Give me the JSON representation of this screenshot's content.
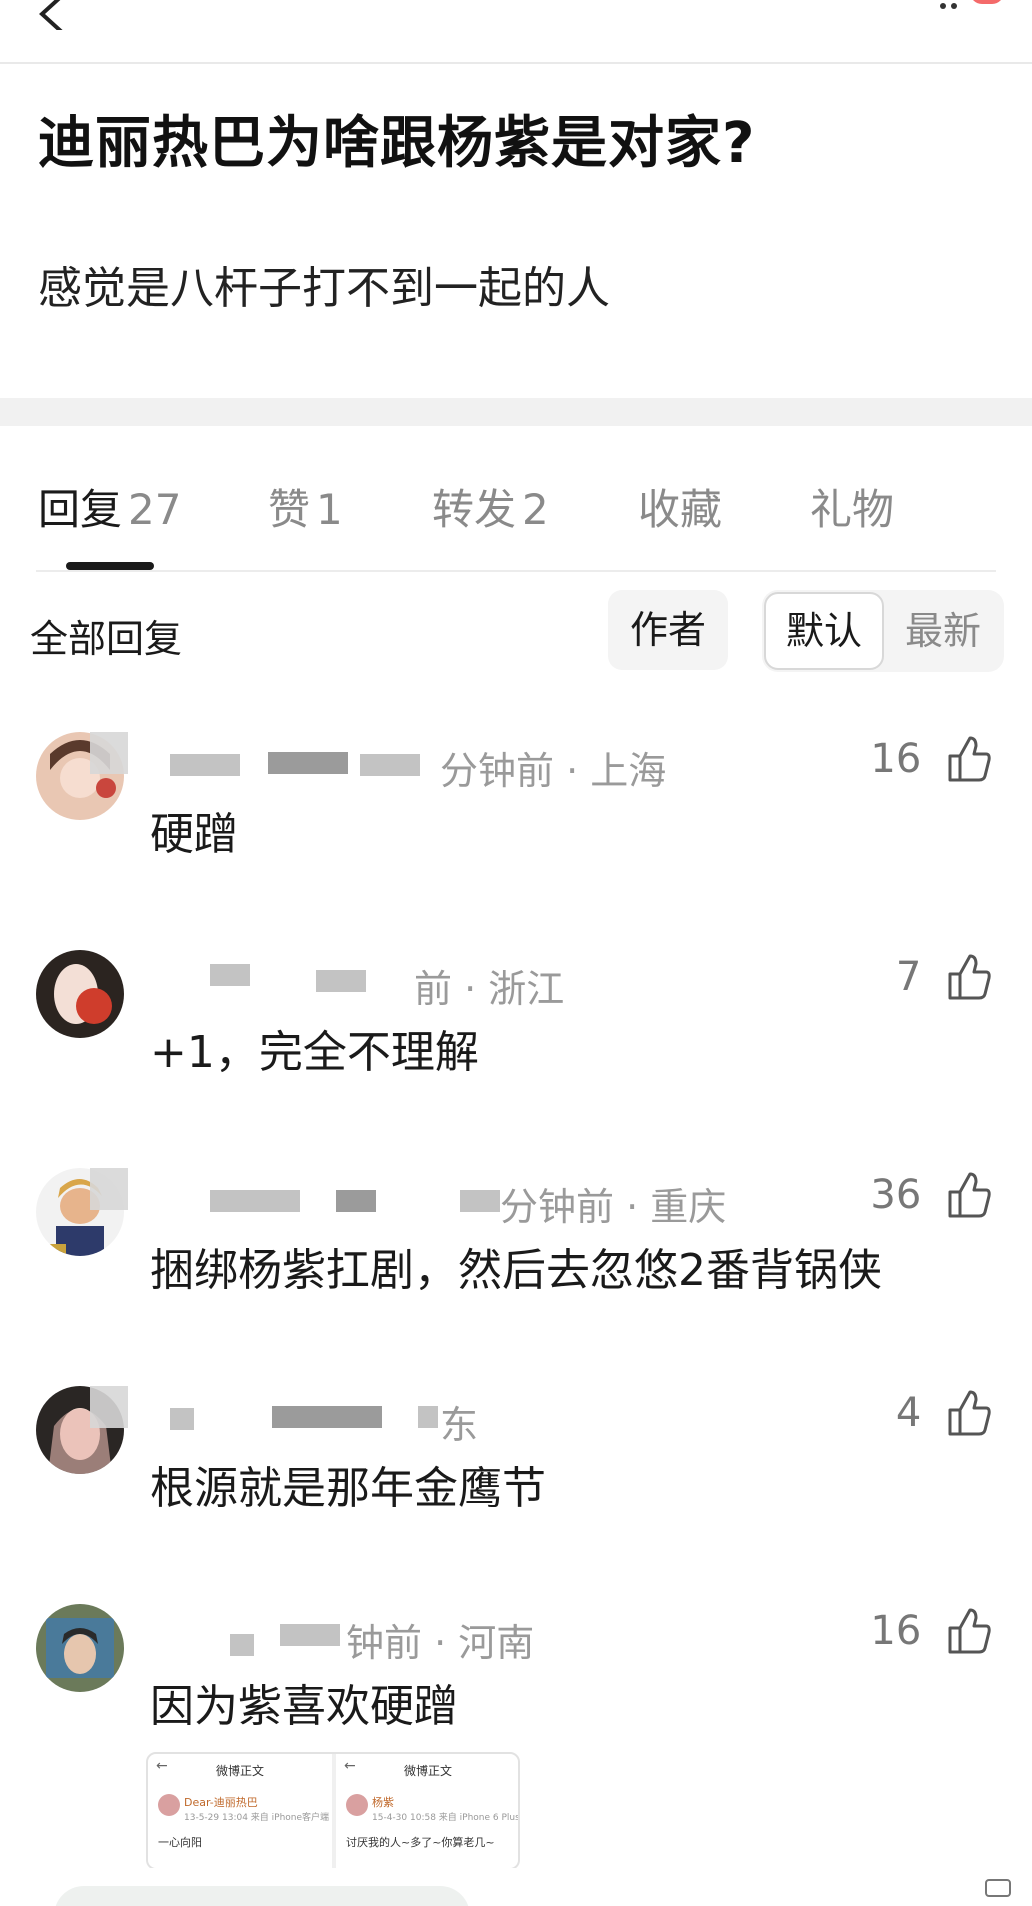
{
  "post": {
    "title": "迪丽热巴为啥跟杨紫是对家?",
    "description": "感觉是八杆子打不到一起的人"
  },
  "tabs": [
    {
      "label": "回复",
      "count": "27"
    },
    {
      "label": "赞",
      "count": "1"
    },
    {
      "label": "转发",
      "count": "2"
    },
    {
      "label": "收藏",
      "count": ""
    },
    {
      "label": "礼物",
      "count": ""
    }
  ],
  "filters": {
    "all_replies": "全部回复",
    "author": "作者",
    "sort_default": "默认",
    "sort_latest": "最新"
  },
  "comments": [
    {
      "meta_visible": "分钟前 · 上海",
      "text": "硬蹭",
      "likes": "16"
    },
    {
      "meta_visible": "前 · 浙江",
      "text": "+1，完全不理解",
      "likes": "7"
    },
    {
      "meta_visible": "分钟前 · 重庆",
      "text": "捆绑杨紫扛剧，然后去忽悠2番背锅侠",
      "likes": "36"
    },
    {
      "meta_visible": "东",
      "text": "根源就是那年金鹰节",
      "likes": "4"
    },
    {
      "meta_visible": "钟前 · 河南",
      "text": "因为紫喜欢硬蹭",
      "likes": "16"
    }
  ],
  "attachments": [
    {
      "header": "微博正文",
      "name": "Dear-迪丽热巴",
      "time": "13-5-29 13:04 来自 iPhone客户端",
      "body": "一心向阳"
    },
    {
      "header": "微博正文",
      "name": "杨紫",
      "time": "15-4-30 10:58 来自 iPhone 6 Plus",
      "body": "讨厌我的人~多了~你算老几~"
    }
  ],
  "colors": {
    "accent_badge": "#f46a6a",
    "text_primary": "#1a1a1a",
    "text_secondary": "#9a9a9a",
    "band": "#f1f1f1"
  },
  "icons": [
    "back-arrow-icon",
    "thumbs-up-icon"
  ]
}
